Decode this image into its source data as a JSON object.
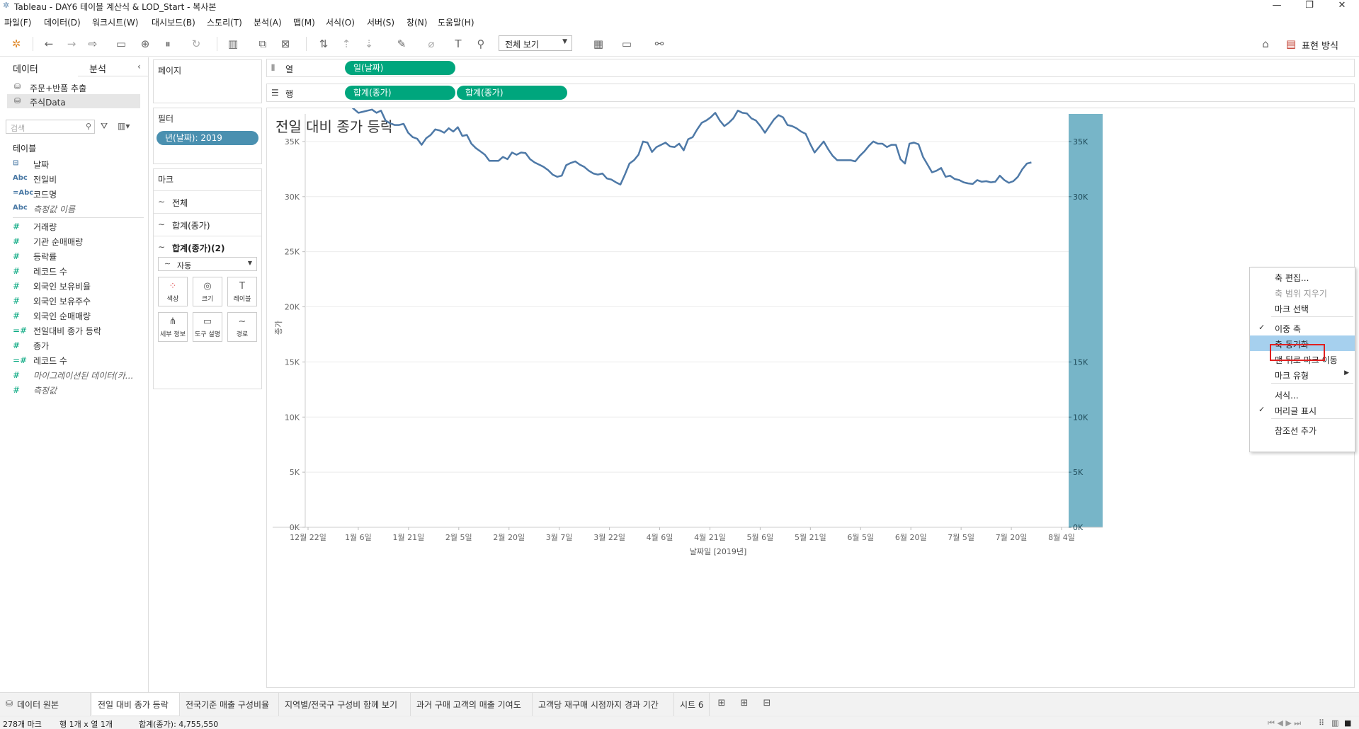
{
  "window": {
    "title": "Tableau - DAY6 테이블 계산식 & LOD_Start - 복사본",
    "controls": [
      "—",
      "❐",
      "✕"
    ]
  },
  "menu": [
    "파일(F)",
    "데이터(D)",
    "워크시트(W)",
    "대시보드(B)",
    "스토리(T)",
    "분석(A)",
    "맵(M)",
    "서식(O)",
    "서버(S)",
    "창(N)",
    "도움말(H)"
  ],
  "toolbar": {
    "fit_label": "전체 보기",
    "show_me_label": "표현 방식"
  },
  "data_pane": {
    "tab_data": "데이터",
    "tab_analysis": "분석",
    "datasources": [
      "주문+반품 추출",
      "주식Data"
    ],
    "search_placeholder": "검색",
    "tables_heading": "테이블",
    "dimensions": [
      {
        "icon": "⊟",
        "label": "날짜"
      },
      {
        "icon": "Abc",
        "label": "전일비"
      },
      {
        "icon": "=Abc",
        "label": "코드명"
      },
      {
        "icon": "Abc",
        "label": "측정값 이름"
      }
    ],
    "measures": [
      {
        "icon": "#",
        "label": "거래량"
      },
      {
        "icon": "#",
        "label": "기관 순매매량"
      },
      {
        "icon": "#",
        "label": "등락률"
      },
      {
        "icon": "#",
        "label": "레코드 수"
      },
      {
        "icon": "#",
        "label": "외국인 보유비율"
      },
      {
        "icon": "#",
        "label": "외국인 보유주수"
      },
      {
        "icon": "#",
        "label": "외국인 순매매량"
      },
      {
        "icon": "=#",
        "label": "전일대비 종가 등락"
      },
      {
        "icon": "#",
        "label": "종가"
      },
      {
        "icon": "=#",
        "label": "레코드 수"
      },
      {
        "icon": "#",
        "label": "마이그레이션된 데이터(카..."
      },
      {
        "icon": "#",
        "label": "측정값"
      }
    ]
  },
  "cards": {
    "pages_title": "페이지",
    "filters_title": "필터",
    "filter_pill": "년(날짜): 2019",
    "marks_title": "마크",
    "marks_rows": [
      "전체",
      "합계(종가)",
      "합계(종가)(2)"
    ],
    "mark_type": "자동",
    "mark_buttons": [
      "색상",
      "크기",
      "레이블",
      "세부 정보",
      "도구 설명",
      "경로"
    ]
  },
  "shelves": {
    "columns_label": "열",
    "rows_label": "행",
    "columns_pill": "일(날짜)",
    "rows_pills": [
      "합계(종가)",
      "합계(종가)"
    ]
  },
  "chart_data": {
    "type": "line",
    "title": "전일 대비 종가 등락",
    "xlabel": "날짜일 [2019년]",
    "ylabel": "종가",
    "x_tick_labels": [
      "12월 22일",
      "1월 6일",
      "1월 21일",
      "2월 5일",
      "2월 20일",
      "3월 7일",
      "3월 22일",
      "4월 6일",
      "4월 21일",
      "5월 6일",
      "5월 21일",
      "6월 5일",
      "6월 20일",
      "7월 5일",
      "7월 20일",
      "8월 4일"
    ],
    "y_tick_labels": [
      "0K",
      "5K",
      "10K",
      "15K",
      "20K",
      "25K",
      "30K",
      "35K"
    ],
    "ylim": [
      0,
      37500
    ],
    "right_axis_labels": [
      "0K",
      "5K",
      "10K",
      "15K",
      "30K",
      "35K"
    ],
    "series": [
      {
        "name": "합계(종가)",
        "color": "#4e79a7",
        "x_start": "2019-01-02",
        "x_end": "2019-07-26",
        "values": [
          38750,
          38300,
          37950,
          37600,
          37700,
          37800,
          37900,
          37600,
          37800,
          36900,
          36650,
          36500,
          36500,
          36600,
          35800,
          35400,
          35250,
          34700,
          35300,
          35600,
          36100,
          36000,
          35800,
          36200,
          35900,
          36300,
          35500,
          35600,
          34800,
          34400,
          34100,
          33800,
          33250,
          33250,
          33250,
          33600,
          33400,
          34000,
          33800,
          34000,
          33950,
          33400,
          33100,
          32900,
          32700,
          32400,
          32000,
          31800,
          31900,
          32850,
          33050,
          33200,
          32900,
          32700,
          32350,
          32100,
          32000,
          32100,
          31650,
          31550,
          31300,
          31100,
          32000,
          33000,
          33300,
          33800,
          35000,
          34900,
          34050,
          34500,
          34700,
          34900,
          34550,
          34500,
          34800,
          34200,
          35200,
          35400,
          36100,
          36700,
          36900,
          37200,
          37600,
          36900,
          36400,
          36700,
          37100,
          37800,
          37600,
          37550,
          37100,
          36900,
          36400,
          35800,
          36400,
          37000,
          37400,
          37200,
          36500,
          36400,
          36200,
          35900,
          35700,
          34800,
          34000,
          34500,
          35000,
          34300,
          33700,
          33300,
          33300,
          33300,
          33300,
          33200,
          33700,
          34100,
          34600,
          35000,
          34800,
          34800,
          34500,
          34700,
          34700,
          33400,
          33000,
          34800,
          34900,
          34750,
          33600,
          32900,
          32200,
          32350,
          32600,
          31800,
          31900,
          31600,
          31500,
          31300,
          31200,
          31150,
          31500,
          31350,
          31400,
          31300,
          31350,
          31900,
          31500,
          31250,
          31400,
          31800,
          32500,
          33000,
          33100
        ]
      }
    ]
  },
  "context_menu": {
    "items": [
      {
        "label": "축 편집...",
        "disabled": false,
        "checked": false,
        "submenu": false
      },
      {
        "label": "축 범위 지우기",
        "disabled": true,
        "checked": false,
        "submenu": false
      },
      {
        "label": "마크 선택",
        "disabled": false,
        "checked": false,
        "submenu": false
      },
      {
        "label": "이중 축",
        "disabled": false,
        "checked": true,
        "submenu": false
      },
      {
        "label": "축 동기화",
        "disabled": false,
        "checked": false,
        "submenu": false,
        "highlighted": true
      },
      {
        "label": "맨 뒤로 마크 이동",
        "disabled": false,
        "checked": false,
        "submenu": false
      },
      {
        "label": "마크 유형",
        "disabled": false,
        "checked": false,
        "submenu": true
      },
      {
        "label": "서식...",
        "disabled": false,
        "checked": false,
        "submenu": false
      },
      {
        "label": "머리글 표시",
        "disabled": false,
        "checked": true,
        "submenu": false
      },
      {
        "label": "참조선 추가",
        "disabled": false,
        "checked": false,
        "submenu": false
      }
    ],
    "check_glyph": "✓"
  },
  "sheets": {
    "datasource_tab": "데이터 원본",
    "tabs": [
      "전일 대비 종가 등락",
      "전국기준 매출 구성비율",
      "지역별/전국구 구성비 함께 보기",
      "과거 구매 고객의 매출 기여도",
      "고객당 재구매 시점까지 경과 기간",
      "시트 6"
    ],
    "active_index": 0
  },
  "status": {
    "marks": "278개 마크",
    "rows_cols": "행 1개 x 열 1개",
    "sum": "합계(종가): 4,755,550"
  },
  "colors": {
    "accent_green": "#00a67d",
    "filter_blue": "#4a90b0",
    "line": "#4e79a7",
    "axis_band": "#77b5c8",
    "highlight": "#a6d0ee",
    "outline_red": "#e02020"
  }
}
